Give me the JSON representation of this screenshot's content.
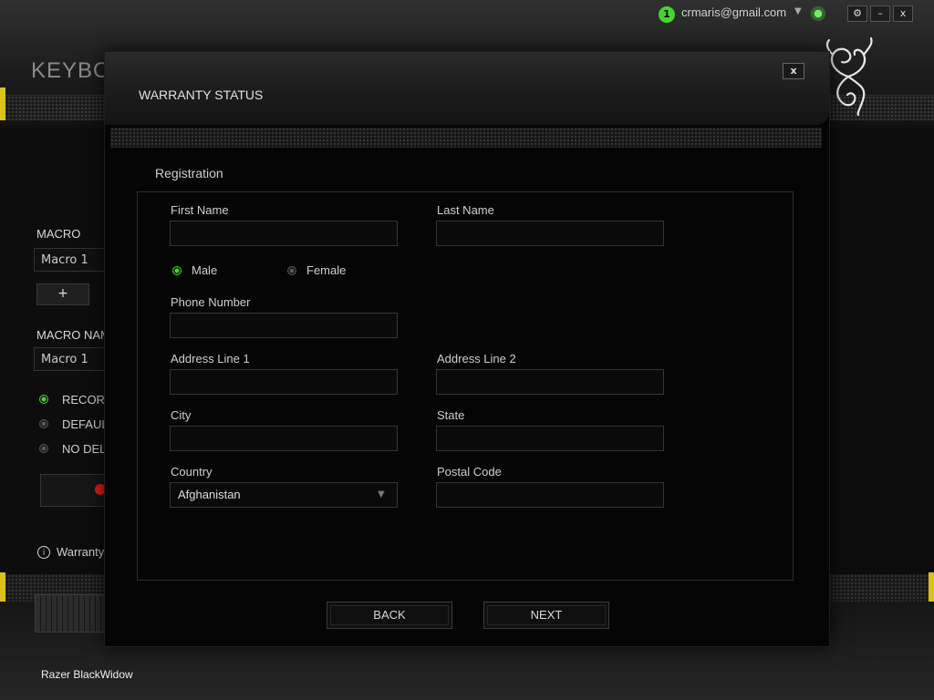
{
  "titlebar": {
    "notification_count": "1",
    "user_email": "crmaris@gmail.com",
    "settings_label": "⚙",
    "minimize_label": "–",
    "close_label": "x"
  },
  "background": {
    "page_heading": "KEYBOA",
    "macro_label": "MACRO",
    "macro_select": "Macro 1",
    "add_button": "+",
    "macro_name_label": "MACRO NAM",
    "macro_name_value": "Macro 1",
    "delay_options": [
      "RECOR",
      "DEFAUL",
      "NO DEL"
    ],
    "warranty_link": "Warranty",
    "device_name": "Razer BlackWidow"
  },
  "modal": {
    "title": "WARRANTY STATUS",
    "close_label": "x",
    "section_title": "Registration",
    "fields": {
      "first_name": {
        "label": "First Name",
        "value": ""
      },
      "last_name": {
        "label": "Last Name",
        "value": ""
      },
      "phone": {
        "label": "Phone Number",
        "value": ""
      },
      "address1": {
        "label": "Address Line 1",
        "value": ""
      },
      "address2": {
        "label": "Address Line 2",
        "value": ""
      },
      "city": {
        "label": "City",
        "value": ""
      },
      "state": {
        "label": "State",
        "value": ""
      },
      "country": {
        "label": "Country",
        "value": "Afghanistan"
      },
      "postal_code": {
        "label": "Postal Code",
        "value": ""
      }
    },
    "gender": {
      "male": "Male",
      "female": "Female",
      "selected": "Male"
    },
    "back_button": "BACK",
    "next_button": "NEXT"
  },
  "colors": {
    "accent": "#44d62c",
    "warning_strip": "#d9c21b"
  }
}
